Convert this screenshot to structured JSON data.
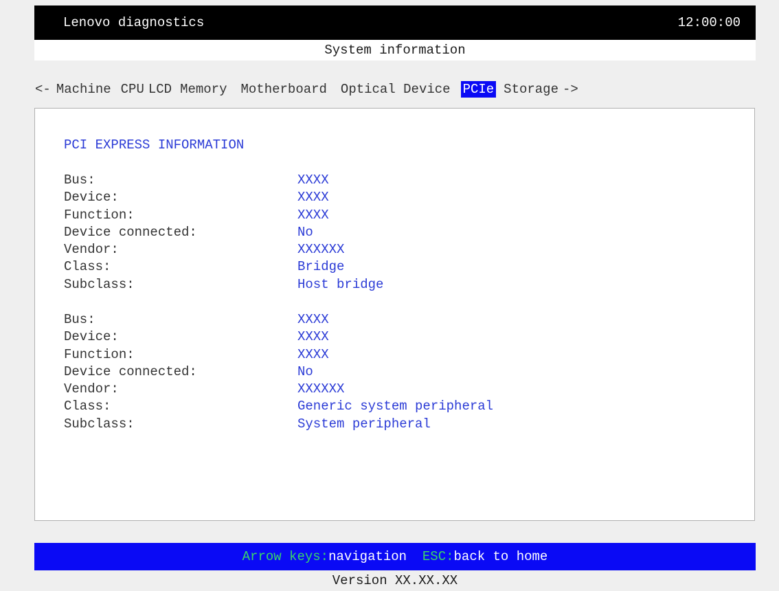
{
  "header": {
    "app_title": "Lenovo diagnostics",
    "clock": "12:00:00"
  },
  "subtitle": "System information",
  "tabs": {
    "prev_arrow": "<-",
    "next_arrow": "->",
    "items": [
      {
        "label": "Machine"
      },
      {
        "label": "CPU"
      },
      {
        "label": "LCD"
      },
      {
        "label": "Memory"
      },
      {
        "label": "Motherboard"
      },
      {
        "label": "Optical Device"
      },
      {
        "label": "PCIe",
        "active": true
      },
      {
        "label": "Storage"
      }
    ]
  },
  "panel": {
    "title": "PCI EXPRESS INFORMATION",
    "devices": [
      {
        "rows": [
          {
            "label": "Bus:",
            "value": "XXXX"
          },
          {
            "label": "Device:",
            "value": "XXXX"
          },
          {
            "label": "Function:",
            "value": "XXXX"
          },
          {
            "label": "Device connected:",
            "value": "No"
          },
          {
            "label": "Vendor:",
            "value": "XXXXXX"
          },
          {
            "label": "Class:",
            "value": "Bridge"
          },
          {
            "label": "Subclass:",
            "value": "Host bridge"
          }
        ]
      },
      {
        "rows": [
          {
            "label": "Bus:",
            "value": "XXXX"
          },
          {
            "label": "Device:",
            "value": "XXXX"
          },
          {
            "label": "Function:",
            "value": "XXXX"
          },
          {
            "label": "Device connected:",
            "value": "No"
          },
          {
            "label": "Vendor:",
            "value": "XXXXXX"
          },
          {
            "label": "Class:",
            "value": "Generic system peripheral"
          },
          {
            "label": "Subclass:",
            "value": "System peripheral"
          }
        ]
      }
    ]
  },
  "footer": {
    "arrow_key": "Arrow keys:",
    "arrow_action": "navigation",
    "esc_key": "ESC:",
    "esc_action": "back to home",
    "version": "Version XX.XX.XX"
  },
  "colors": {
    "accent_blue": "#0a0af5",
    "value_text": "#2b3bd6",
    "key_hint_green": "#39d66a",
    "header_bg": "#000000",
    "page_bg": "#efefef"
  }
}
